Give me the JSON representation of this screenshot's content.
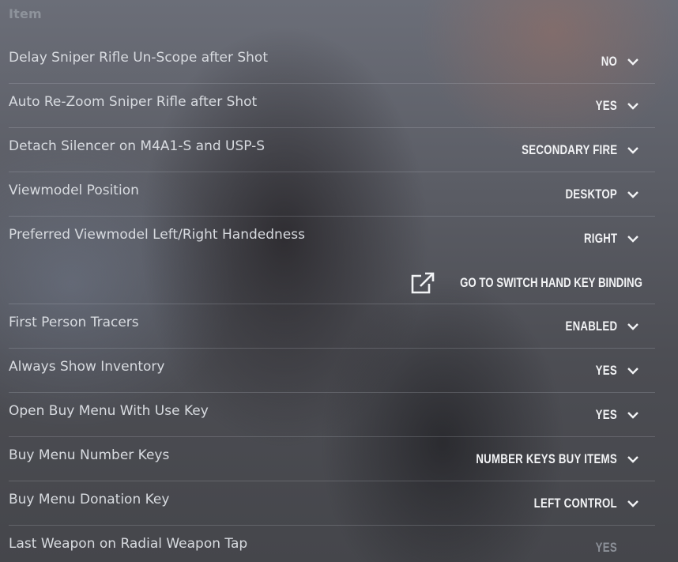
{
  "section": {
    "title": "Item"
  },
  "rows": [
    {
      "label": "Delay Sniper Rifle Un-Scope after Shot",
      "value": "NO"
    },
    {
      "label": "Auto Re-Zoom Sniper Rifle after Shot",
      "value": "YES"
    },
    {
      "label": "Detach Silencer on M4A1-S and USP-S",
      "value": "SECONDARY FIRE"
    },
    {
      "label": "Viewmodel Position",
      "value": "DESKTOP"
    },
    {
      "label": "Preferred Viewmodel Left/Right Handedness",
      "value": "RIGHT",
      "link_label": "GO TO SWITCH HAND KEY BINDING"
    },
    {
      "label": "First Person Tracers",
      "value": "ENABLED"
    },
    {
      "label": "Always Show Inventory",
      "value": "YES"
    },
    {
      "label": "Open Buy Menu With Use Key",
      "value": "YES"
    },
    {
      "label": "Buy Menu Number Keys",
      "value": "NUMBER KEYS BUY ITEMS"
    },
    {
      "label": "Buy Menu Donation Key",
      "value": "LEFT CONTROL"
    },
    {
      "label": "Last Weapon on Radial Weapon Tap",
      "value": "YES",
      "disabled": true
    }
  ],
  "icons": {
    "dropdown": "chevron-down-icon",
    "link": "external-link-icon"
  },
  "colors": {
    "label": "#d8dbe0",
    "value": "#f2f3f5",
    "section_title": "#8e939b",
    "disabled_value": "#8c9098"
  }
}
